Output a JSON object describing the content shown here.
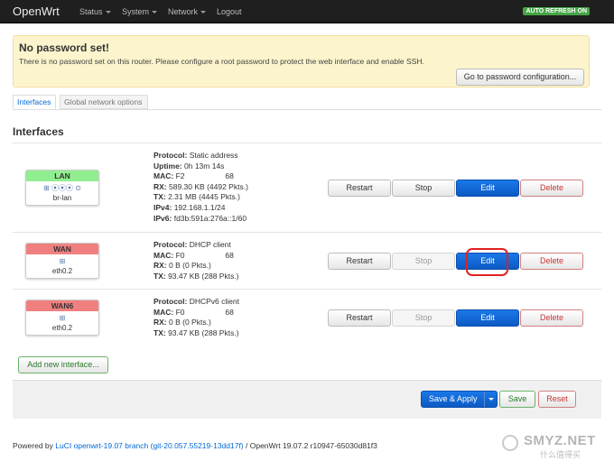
{
  "navbar": {
    "brand": "OpenWrt",
    "items": [
      "Status",
      "System",
      "Network",
      "Logout"
    ],
    "auto_refresh": "AUTO REFRESH ON"
  },
  "alert": {
    "title": "No password set!",
    "text": "There is no password set on this router. Please configure a root password to protect the web interface and enable SSH.",
    "button": "Go to password configuration..."
  },
  "tabs": [
    "Interfaces",
    "Global network options"
  ],
  "section_title": "Interfaces",
  "interfaces": [
    {
      "name": "LAN",
      "device": "br-lan",
      "status_color": "#90ee90",
      "lines": [
        {
          "label": "Protocol:",
          "value": "Static address"
        },
        {
          "label": "Uptime:",
          "value": "0h 13m 14s"
        },
        {
          "label": "MAC:",
          "value": "F2                   68"
        },
        {
          "label": "RX:",
          "value": "589.30 KB (4492 Pkts.)"
        },
        {
          "label": "TX:",
          "value": "2.31 MB (4445 Pkts.)"
        },
        {
          "label": "IPv4:",
          "value": "192.168.1.1/24"
        },
        {
          "label": "IPv6:",
          "value": "fd3b:591a:276a::1/60"
        }
      ]
    },
    {
      "name": "WAN",
      "device": "eth0.2",
      "status_color": "#f08080",
      "lines": [
        {
          "label": "Protocol:",
          "value": "DHCP client"
        },
        {
          "label": "MAC:",
          "value": "F0                   68"
        },
        {
          "label": "RX:",
          "value": "0 B (0 Pkts.)"
        },
        {
          "label": "TX:",
          "value": "93.47 KB (288 Pkts.)"
        }
      ]
    },
    {
      "name": "WAN6",
      "device": "eth0.2",
      "status_color": "#f08080",
      "lines": [
        {
          "label": "Protocol:",
          "value": "DHCPv6 client"
        },
        {
          "label": "MAC:",
          "value": "F0                   68"
        },
        {
          "label": "RX:",
          "value": "0 B (0 Pkts.)"
        },
        {
          "label": "TX:",
          "value": "93.47 KB (288 Pkts.)"
        }
      ]
    }
  ],
  "row_buttons": {
    "restart": "Restart",
    "stop": "Stop",
    "edit": "Edit",
    "delete": "Delete"
  },
  "add_button": "Add new interface...",
  "footer_buttons": {
    "save_apply": "Save & Apply",
    "save": "Save",
    "reset": "Reset"
  },
  "powered": {
    "prefix": "Powered by ",
    "link": "LuCI openwrt-19.07 branch (git-20.057.55219-13dd17f)",
    "suffix": " / OpenWrt 19.07.2 r10947-65030d81f3"
  },
  "watermark": {
    "text": "SMYZ.NET",
    "sub": "什么值得买"
  }
}
